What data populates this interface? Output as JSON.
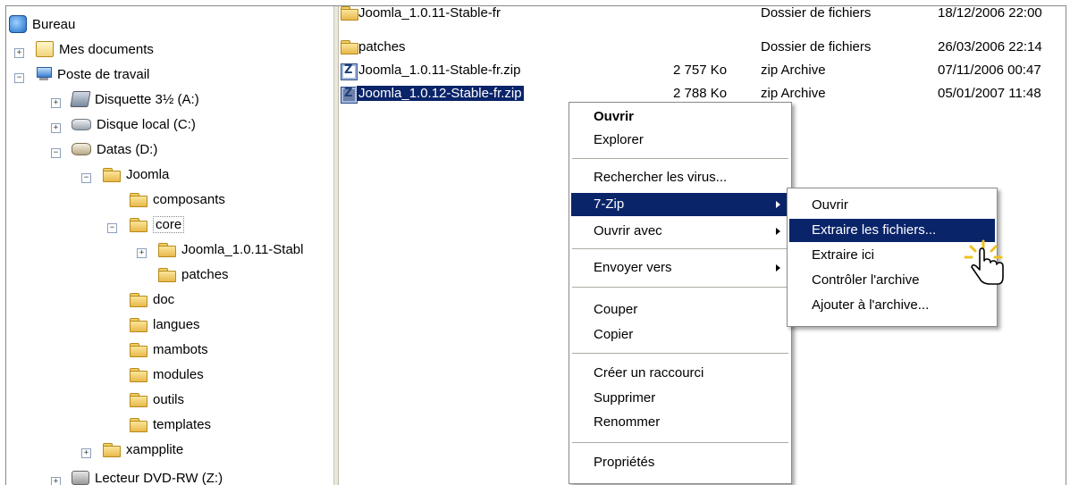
{
  "tree": {
    "items": [
      {
        "label": "Bureau",
        "icon": "desktop-icon"
      },
      {
        "label": "Mes documents",
        "icon": "my-documents-icon"
      },
      {
        "label": "Poste de travail",
        "icon": "my-computer-icon"
      },
      {
        "label": "Disquette 3½ (A:)",
        "icon": "floppy-drive-icon"
      },
      {
        "label": "Disque local (C:)",
        "icon": "hard-drive-icon"
      },
      {
        "label": "Datas (D:)",
        "icon": "hard-drive-icon"
      },
      {
        "label": "Joomla",
        "icon": "folder-icon"
      },
      {
        "label": "composants",
        "icon": "folder-icon"
      },
      {
        "label": "core",
        "icon": "folder-icon"
      },
      {
        "label": "Joomla_1.0.11-Stabl",
        "icon": "folder-icon"
      },
      {
        "label": "patches",
        "icon": "folder-icon"
      },
      {
        "label": "doc",
        "icon": "folder-icon"
      },
      {
        "label": "langues",
        "icon": "folder-icon"
      },
      {
        "label": "mambots",
        "icon": "folder-icon"
      },
      {
        "label": "modules",
        "icon": "folder-icon"
      },
      {
        "label": "outils",
        "icon": "folder-icon"
      },
      {
        "label": "templates",
        "icon": "folder-icon"
      },
      {
        "label": "xampplite",
        "icon": "folder-icon"
      },
      {
        "label": "Lecteur DVD-RW (Z:)",
        "icon": "dvd-drive-icon"
      }
    ],
    "expanders": [
      "+",
      "−",
      "+",
      "+",
      "−",
      "−",
      "−",
      "+",
      "+",
      "+"
    ]
  },
  "files": {
    "rows": [
      {
        "name": "Joomla_1.0.11-Stable-fr",
        "size": "",
        "type": "Dossier de fichiers",
        "modified": "18/12/2006 22:00",
        "icon": "folder-icon"
      },
      {
        "name": "patches",
        "size": "",
        "type": "Dossier de fichiers",
        "modified": "26/03/2006 22:14",
        "icon": "folder-icon"
      },
      {
        "name": "Joomla_1.0.11-Stable-fr.zip",
        "size": "2 757 Ko",
        "type": "zip Archive",
        "modified": "07/11/2006 00:47",
        "icon": "zip-archive-icon"
      },
      {
        "name": "Joomla_1.0.12-Stable-fr.zip",
        "size": "2 788 Ko",
        "type": "zip Archive",
        "modified": "05/01/2007 11:48",
        "icon": "zip-archive-icon"
      }
    ]
  },
  "context_menu": {
    "open": "Ouvrir",
    "explore": "Explorer",
    "scan": "Rechercher les virus...",
    "sevenzip": "7-Zip",
    "open_with": "Ouvrir avec",
    "send_to": "Envoyer vers",
    "cut": "Couper",
    "copy": "Copier",
    "shortcut": "Créer un raccourci",
    "delete": "Supprimer",
    "rename": "Renommer",
    "properties": "Propriétés"
  },
  "submenu": {
    "open": "Ouvrir",
    "extract_files": "Extraire les fichiers...",
    "extract_here": "Extraire ici",
    "test": "Contrôler l'archive",
    "add": "Ajouter à l'archive..."
  },
  "colors": {
    "selection": "#0a246a",
    "accent_flash": "#f0c020"
  }
}
